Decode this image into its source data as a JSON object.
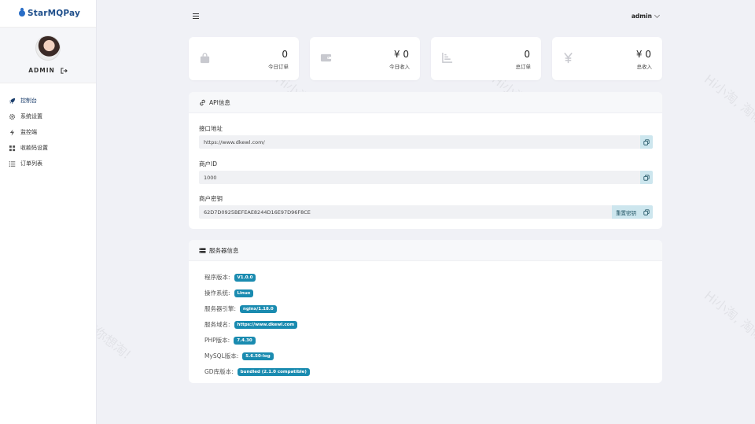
{
  "brand": {
    "name": "StarMQPay"
  },
  "profile": {
    "name": "ADMIN"
  },
  "nav": {
    "items": [
      {
        "label": "控制台",
        "icon": "rocket-icon"
      },
      {
        "label": "系统设置",
        "icon": "gear-icon"
      },
      {
        "label": "监控端",
        "icon": "bolt-icon"
      },
      {
        "label": "收款码设置",
        "icon": "grid-icon"
      },
      {
        "label": "订单列表",
        "icon": "list-icon"
      }
    ]
  },
  "header": {
    "user": "admin"
  },
  "stats": [
    {
      "value": "0",
      "label": "今日订单",
      "icon": "bag-icon"
    },
    {
      "value": "¥ 0",
      "label": "今日收入",
      "icon": "wallet-icon"
    },
    {
      "value": "0",
      "label": "总订单",
      "icon": "chart-icon"
    },
    {
      "value": "¥ 0",
      "label": "总收入",
      "icon": "yen-icon"
    }
  ],
  "api": {
    "title": "API信息",
    "fields": [
      {
        "label": "接口地址",
        "value": "https://www.dkewl.com/"
      },
      {
        "label": "商户ID",
        "value": "1000"
      },
      {
        "label": "商户密钥",
        "value": "62D7D0925BEFEAE8244D16E97D96F8CE"
      }
    ],
    "reset_label": "重置密钥"
  },
  "server": {
    "title": "服务器信息",
    "rows": [
      {
        "label": "程序版本:",
        "value": "V1.0.0"
      },
      {
        "label": "操作系统:",
        "value": "Linux"
      },
      {
        "label": "服务器引擎:",
        "value": "nginx/1.18.0"
      },
      {
        "label": "服务域名:",
        "value": "https://www.dkewl.com"
      },
      {
        "label": "PHP版本:",
        "value": "7.4.30"
      },
      {
        "label": "MySQL版本:",
        "value": "5.6.50-log"
      },
      {
        "label": "GD库版本:",
        "value": "bundled (2.1.0 compatible)"
      }
    ]
  },
  "watermark": "Hi小淘, 淘你想淘!",
  "colors": {
    "accent": "#1a8bb0",
    "brand": "#2a6ec7",
    "copy_bg": "#cde6ee"
  }
}
